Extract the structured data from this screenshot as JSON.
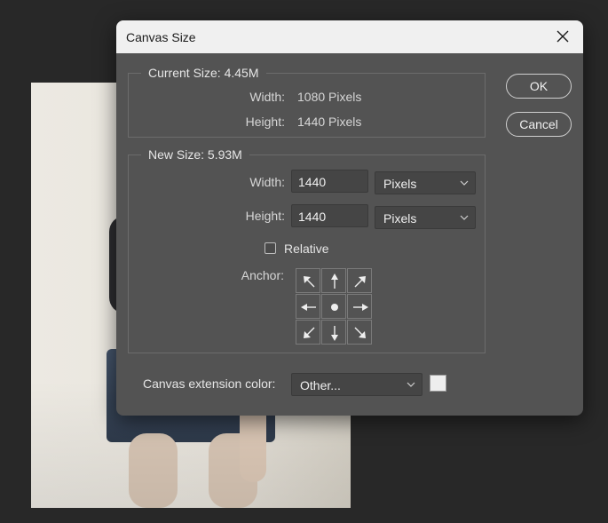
{
  "dialog": {
    "title": "Canvas Size",
    "ok_label": "OK",
    "cancel_label": "Cancel"
  },
  "current_size": {
    "legend": "Current Size: 4.45M",
    "width_label": "Width:",
    "width_value": "1080 Pixels",
    "height_label": "Height:",
    "height_value": "1440 Pixels"
  },
  "new_size": {
    "legend": "New Size: 5.93M",
    "width_label": "Width:",
    "width_value": "1440",
    "width_unit": "Pixels",
    "height_label": "Height:",
    "height_value": "1440",
    "height_unit": "Pixels",
    "relative_label": "Relative",
    "relative_checked": false,
    "anchor_label": "Anchor:",
    "anchor_selected": "center"
  },
  "extension": {
    "label": "Canvas extension color:",
    "value": "Other...",
    "swatch_color": "#eeeeee"
  },
  "icons": {
    "close": "close-icon",
    "dropdown": "chevron-down-icon",
    "anchor_arrows": [
      "arrow-up-left-icon",
      "arrow-up-icon",
      "arrow-up-right-icon",
      "arrow-left-icon",
      "anchor-center-dot-icon",
      "arrow-right-icon",
      "arrow-down-left-icon",
      "arrow-down-icon",
      "arrow-down-right-icon"
    ]
  }
}
